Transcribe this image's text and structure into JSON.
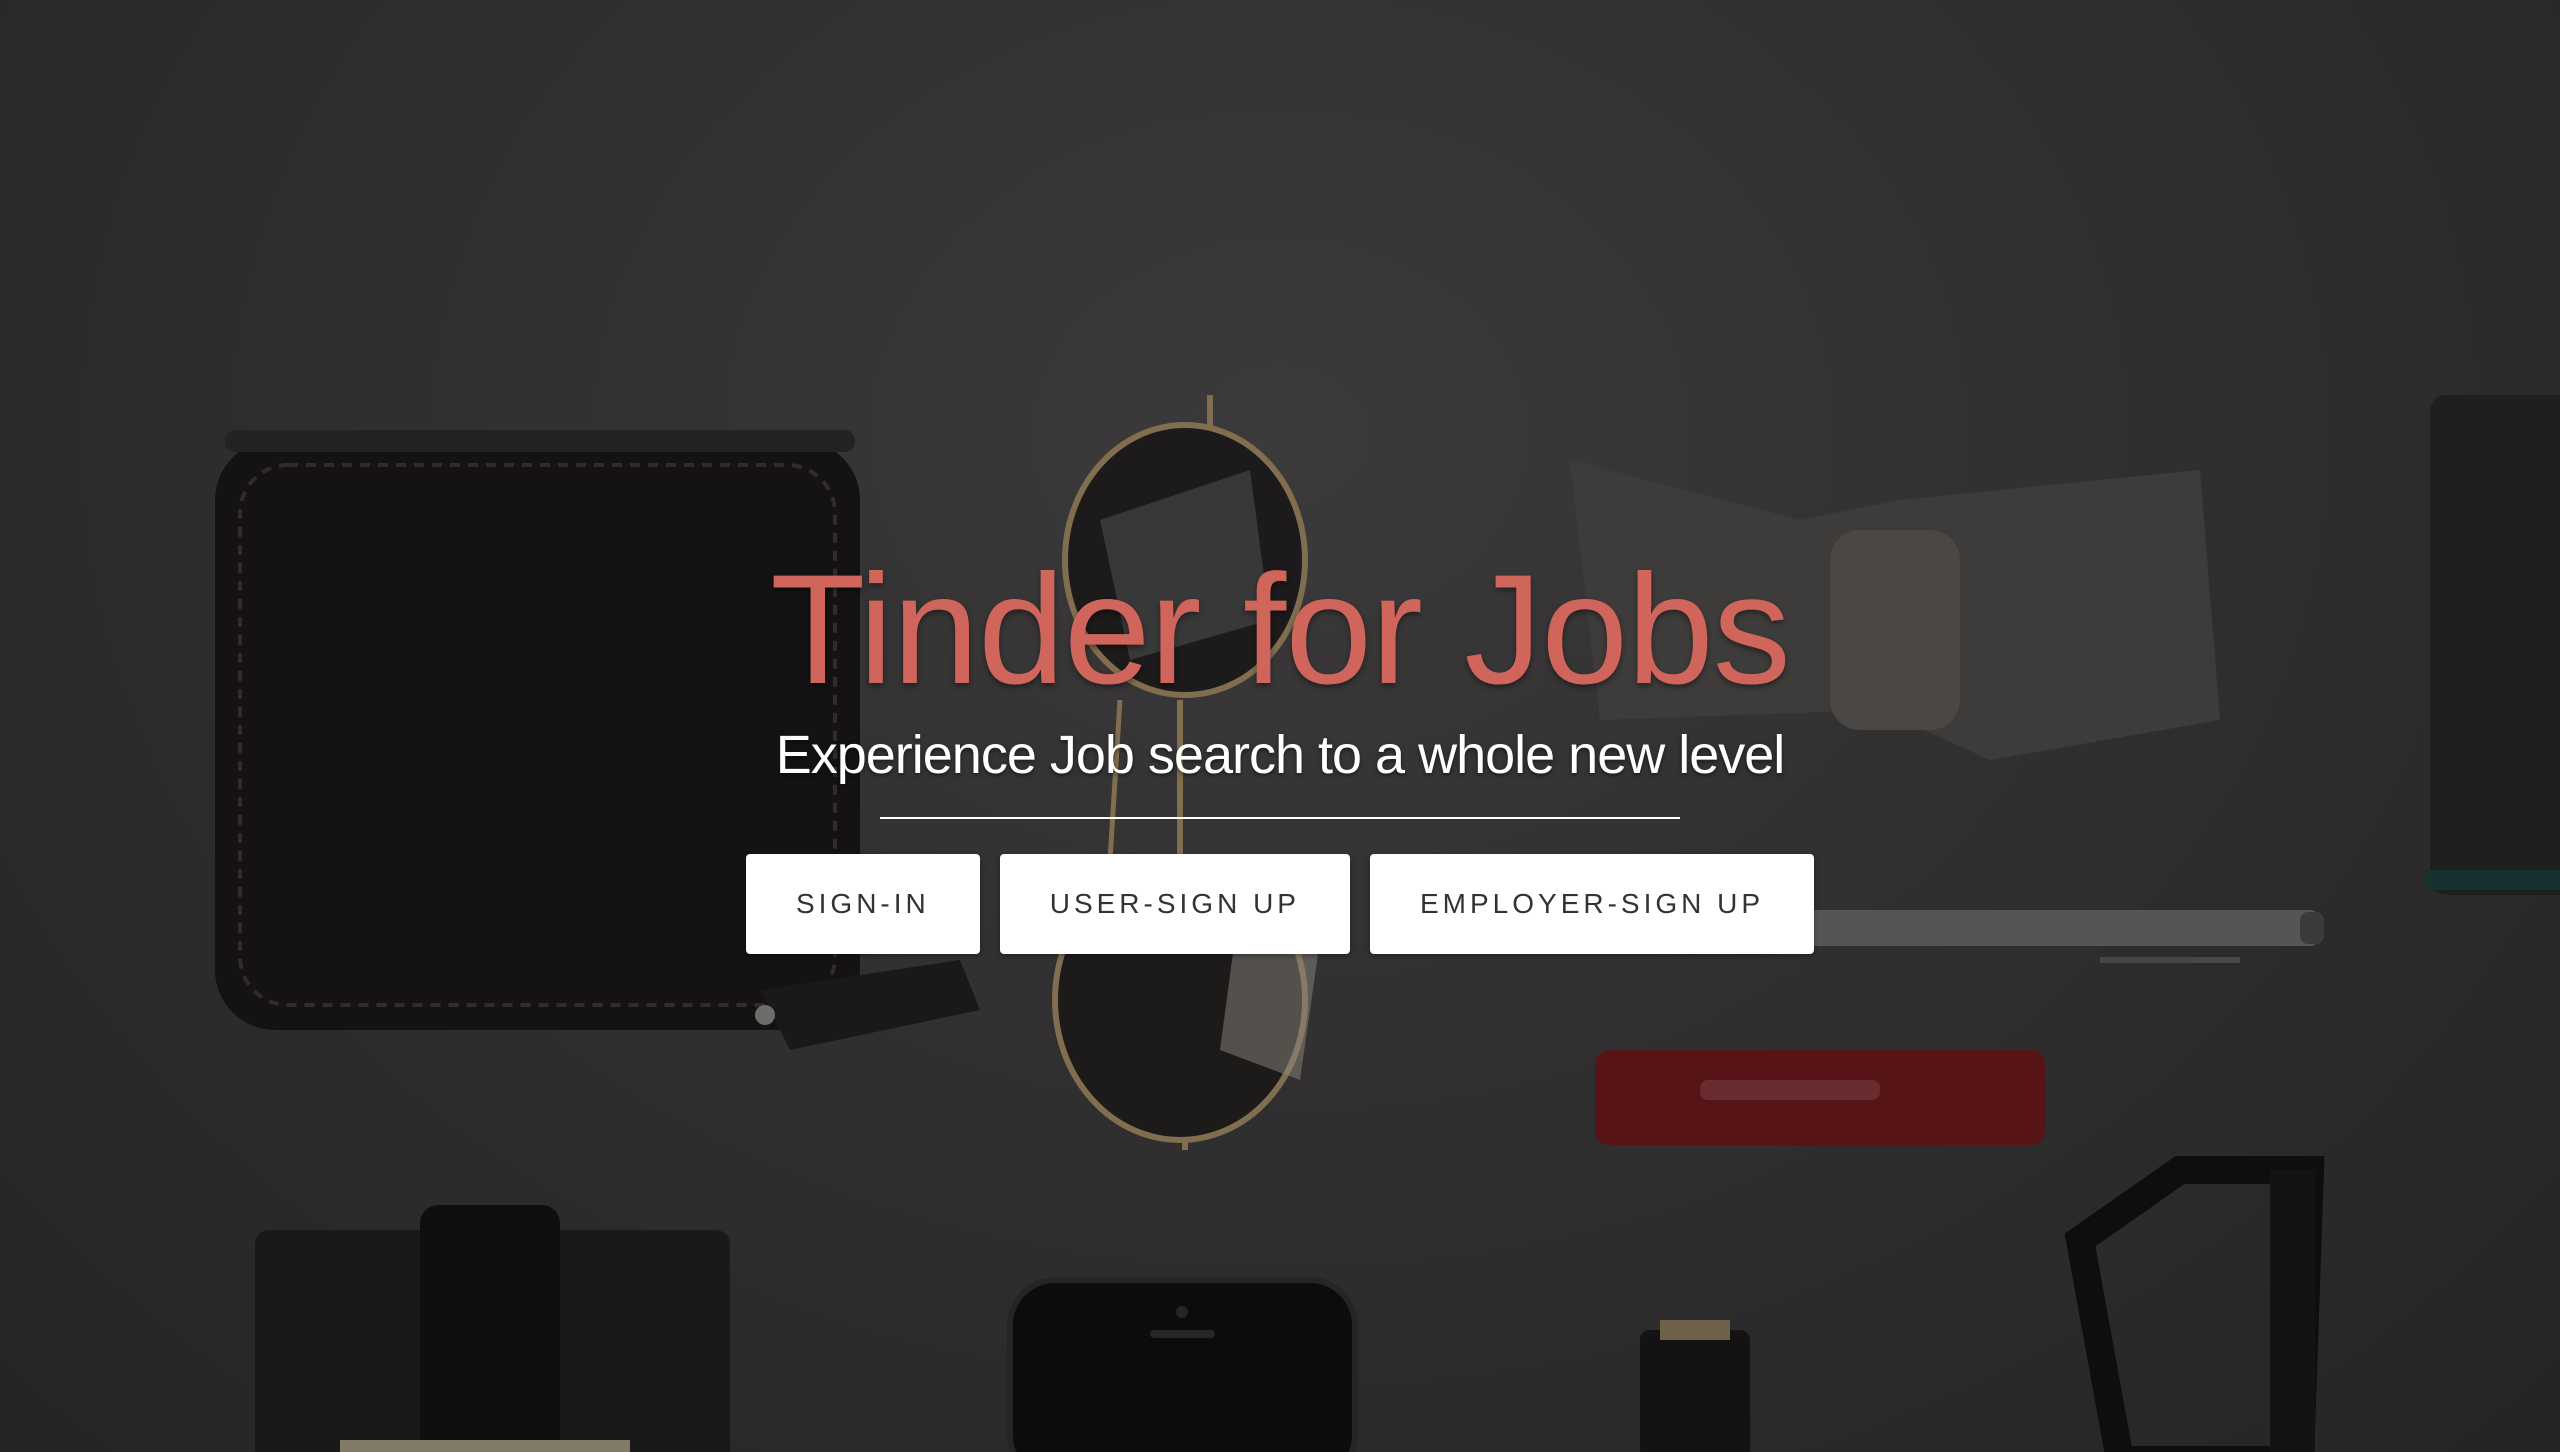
{
  "hero": {
    "title": "Tinder for Jobs",
    "subtitle": "Experience Job search to a whole new level",
    "title_color": "#d0665b"
  },
  "buttons": {
    "signin": "SIGN-IN",
    "user_signup": "USER-SIGN UP",
    "employer_signup": "EMPLOYER-SIGN UP"
  },
  "background_items": [
    "wallet",
    "sunglasses",
    "bow-tie",
    "notebook",
    "pen",
    "red-lip-balm",
    "card-holder",
    "smartphone",
    "watch",
    "eyeglasses"
  ]
}
